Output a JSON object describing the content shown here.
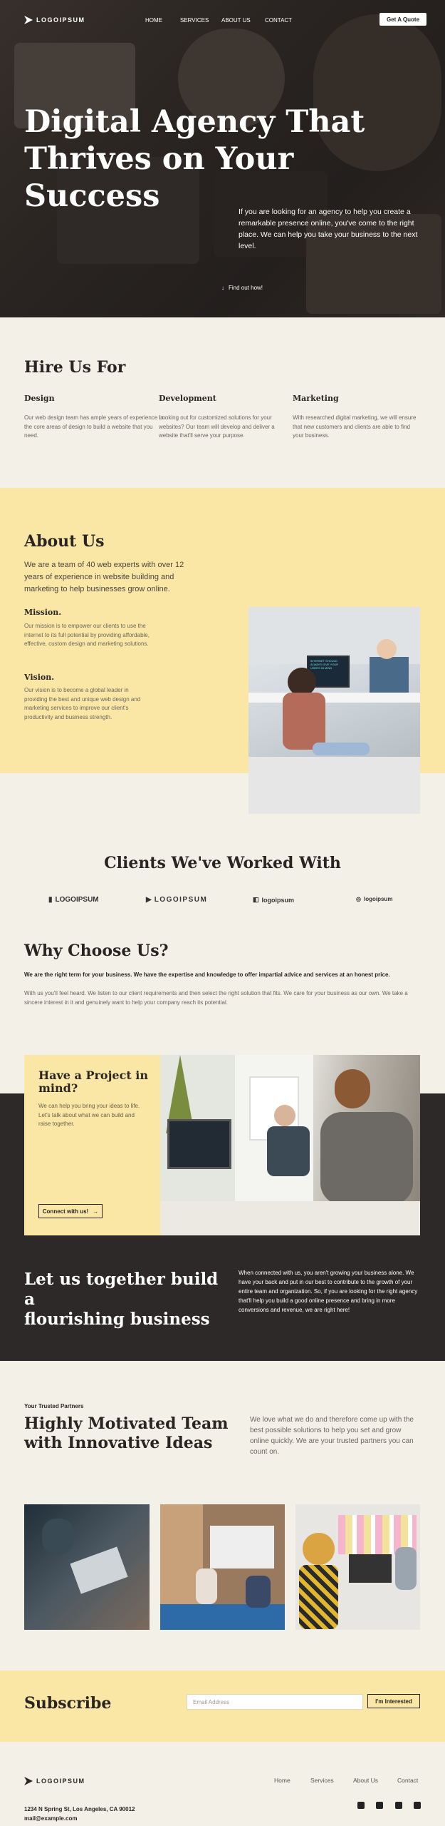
{
  "colors": {
    "accent": "#fae7a5",
    "dark": "#2d2928",
    "bg": "#f3f0e7"
  },
  "header": {
    "logo": "LOGOIPSUM",
    "nav": [
      "HOME",
      "SERVICES",
      "ABOUT US",
      "CONTACT"
    ],
    "cta": "Get A Quote"
  },
  "hero": {
    "title_line1": "Digital Agency That",
    "title_line2": "Thrives on Your Success",
    "description": "If you are looking for an agency to help you create a remarkable presence online, you've come to the right place. We can help you take your business to the next level.",
    "find_out": "Find out how!",
    "find_out_icon": "arrow-down-icon"
  },
  "hire": {
    "title": "Hire Us For",
    "items": [
      {
        "title": "Design",
        "text": "Our web design team has ample years of experience in the core areas of design to build a website that you need."
      },
      {
        "title": "Development",
        "text": "Looking out for customized solutions for your websites? Our team will develop and deliver a website that'll serve your purpose."
      },
      {
        "title": "Marketing",
        "text": "With researched digital marketing, we will ensure that new customers and clients are able to find your business."
      }
    ]
  },
  "about": {
    "title": "About Us",
    "intro": "We are a team of 40 web experts with over 12 years of experience in website building and marketing to help businesses grow online.",
    "mission_title": "Mission.",
    "mission_text": "Our mission is to empower our clients to use the internet to its full potential by providing affordable, effective, custom design and marketing solutions.",
    "vision_title": "Vision.",
    "vision_text": "Our vision is to become a global leader in providing the best and unique web design and marketing services to improve our client's productivity and business strength.",
    "screen_text": "INTERNET SHOULD ALWAYS GIVE YOUR USERS IN MIND"
  },
  "clients": {
    "title": "Clients We've Worked With",
    "logos": [
      "LOGOIPSUM",
      "LOGOIPSUM",
      "logoipsum",
      "logoipsum"
    ]
  },
  "why": {
    "title": "Why Choose Us?",
    "bold_text": "We are the right term for your business. We have the expertise and knowledge to offer impartial advice and services at an honest price.",
    "text": "With us you'll feel heard. We listen to our client requirements and then select the right solution that fits. We care for your business as our own. We take a sincere interest in it and genuinely want to help your company reach its potential."
  },
  "project": {
    "title": "Have a Project in mind?",
    "text": "We can help you bring your ideas to life. Let's talk about what we can build and raise together.",
    "button": "Connect with us!",
    "button_icon": "arrow-right-icon"
  },
  "together": {
    "title_line1": "Let us together build a",
    "title_line2": "flourishing business",
    "text": "When connected with us, you aren't growing your business alone. We have your back and put in our best to contribute to the growth of your entire team and organization. So, if you are looking for the right agency that'll help you build a good online presence and bring in more conversions and revenue, we are right here!"
  },
  "team": {
    "eyebrow": "Your Trusted Partners",
    "title_line1": "Highly Motivated Team",
    "title_line2": "with Innovative Ideas",
    "text": "We love what we do and therefore come up with the best possible solutions to help you set and grow online quickly. We are your trusted partners you can count on."
  },
  "subscribe": {
    "title": "Subscribe",
    "placeholder": "Email Address",
    "button": "I'm Interested"
  },
  "footer": {
    "logo": "LOGOIPSUM",
    "links": [
      "Home",
      "Services",
      "About Us",
      "Contact"
    ],
    "address": "1234 N Spring St, Los Angeles, CA 90012",
    "email": "mail@example.com",
    "social": [
      "twitter-icon",
      "youtube-icon",
      "facebook-icon",
      "instagram-icon"
    ]
  }
}
